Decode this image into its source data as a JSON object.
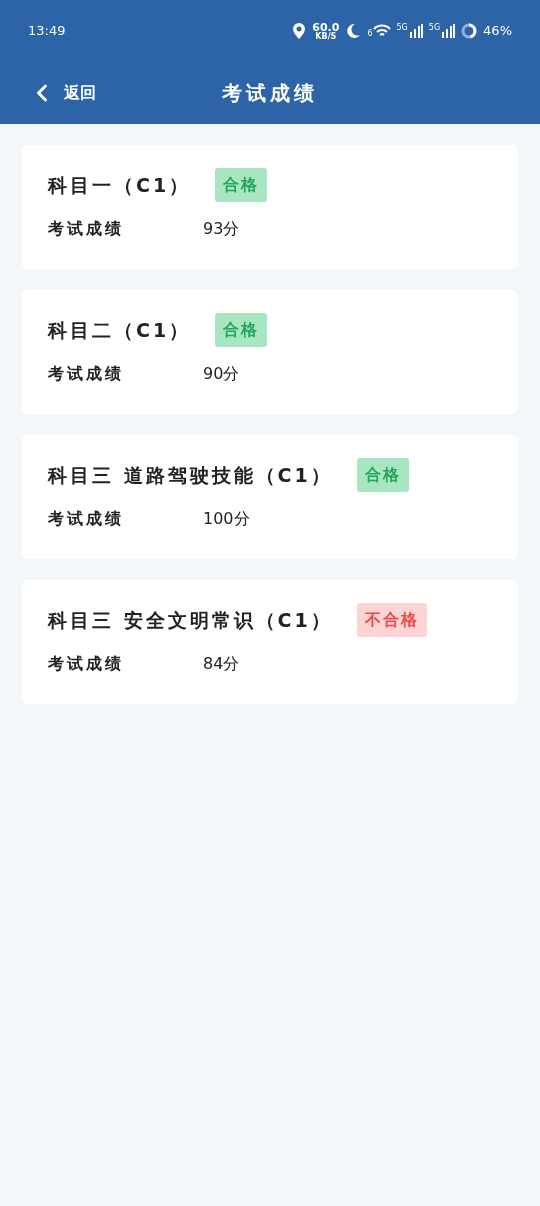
{
  "status_bar": {
    "time": "13:49",
    "speed": "60.0",
    "speed_unit": "KB/S",
    "wifi_label": "6",
    "signal_labels": [
      "5G",
      "5G"
    ],
    "battery": "46%"
  },
  "header": {
    "back": "返回",
    "title": "考试成绩"
  },
  "results": [
    {
      "subject": "科目一（C1）",
      "kind": "pass",
      "badge": "合格",
      "label": "考试成绩",
      "score": "93分"
    },
    {
      "subject": "科目二（C1）",
      "kind": "pass",
      "badge": "合格",
      "label": "考试成绩",
      "score": "90分"
    },
    {
      "subject": "科目三 道路驾驶技能（C1）",
      "kind": "pass",
      "badge": "合格",
      "label": "考试成绩",
      "score": "100分"
    },
    {
      "subject": "科目三 安全文明常识（C1）",
      "kind": "fail",
      "badge": "不合格",
      "label": "考试成绩",
      "score": "84分"
    }
  ]
}
